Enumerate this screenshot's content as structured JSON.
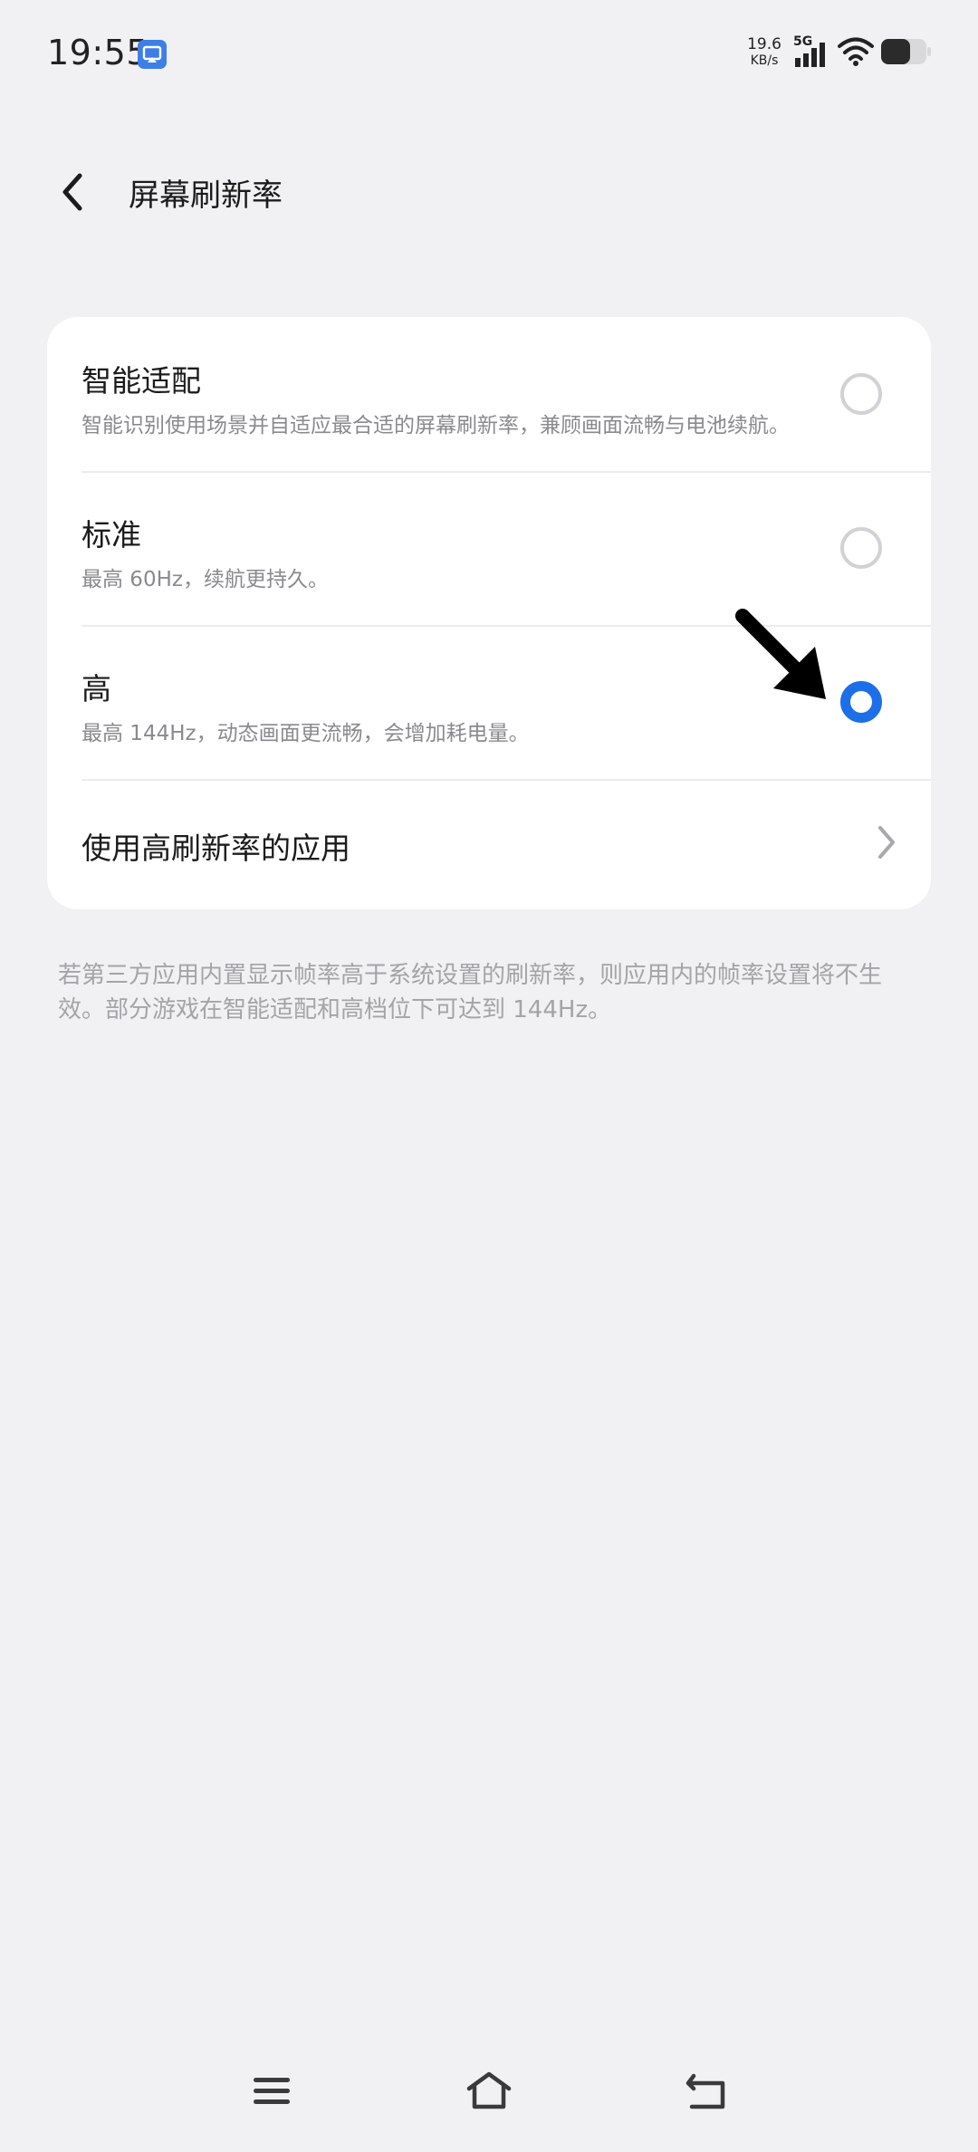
{
  "status_bar": {
    "time": "19:55",
    "net_speed_value": "19.6",
    "net_speed_unit": "KB/s",
    "network_type": "5G",
    "icons": [
      "screen-cast-icon",
      "signal-icon",
      "wifi-icon",
      "battery-icon"
    ]
  },
  "header": {
    "title": "屏幕刷新率",
    "back_icon": "chevron-left-icon"
  },
  "options": [
    {
      "title": "智能适配",
      "description": "智能识别使用场景并自适应最合适的屏幕刷新率，兼顾画面流畅与电池续航。",
      "selected": false
    },
    {
      "title": "标准",
      "description": "最高 60Hz，续航更持久。",
      "selected": false
    },
    {
      "title": "高",
      "description": "最高 144Hz，动态画面更流畅，会增加耗电量。",
      "selected": true
    }
  ],
  "link": {
    "label": "使用高刷新率的应用",
    "icon": "chevron-right-icon"
  },
  "footnote": "若第三方应用内置显示帧率高于系统设置的刷新率，则应用内的帧率设置将不生效。部分游戏在智能适配和高档位下可达到 144Hz。",
  "nav_bar": {
    "icons": [
      "menu-icon",
      "home-icon",
      "back-icon"
    ]
  },
  "colors": {
    "accent": "#1d6fe8",
    "background": "#f1f1f3",
    "card": "#ffffff",
    "secondary_text": "#8a8a8e"
  }
}
